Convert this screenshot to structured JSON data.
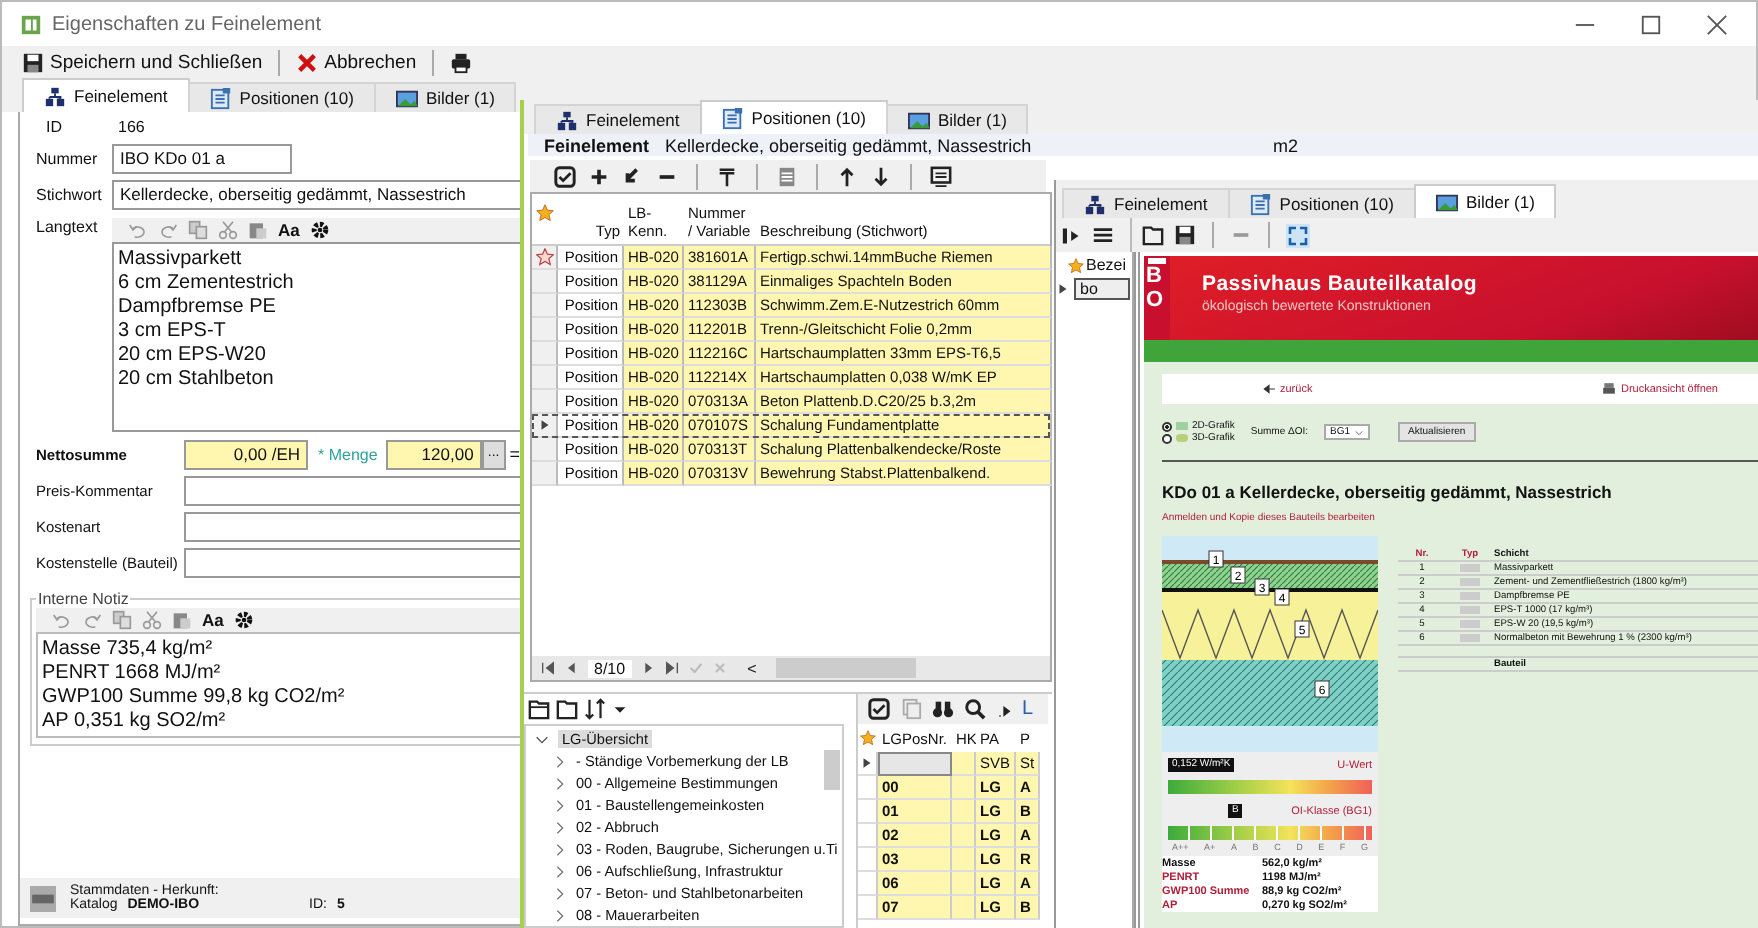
{
  "window": {
    "title": "Eigenschaften zu Feinelement"
  },
  "toolbar": [
    {
      "kind": "save",
      "label": "Speichern und Schließen"
    },
    {
      "kind": "cancel",
      "label": "Abbrechen"
    },
    {
      "kind": "print"
    }
  ],
  "tabs": [
    {
      "kind": "element",
      "label": "Feinelement",
      "selected": true
    },
    {
      "kind": "positions",
      "label": "Positionen (10)",
      "selected": false
    },
    {
      "kind": "images",
      "label": "Bilder (1)",
      "selected": false
    }
  ],
  "form": {
    "id_label": "ID",
    "id_value": "166",
    "fields": [
      {
        "label": "Nummer",
        "value": "IBO KDo  01 a"
      },
      {
        "label": "Stichwort",
        "value": "Kellerdecke, oberseitig gedämmt, Nassestrich"
      }
    ],
    "langtext": {
      "label": "Langtext",
      "font_button": "Aa",
      "lines": [
        "Massivparkett",
        "6 cm Zementestrich",
        "Dampfbremse PE",
        "3 cm EPS-T",
        "20 cm EPS-W20",
        "20 cm Stahlbeton"
      ]
    },
    "nettosumme": {
      "label": "Nettosumme",
      "price": "0,00 /EH",
      "quantity_label": "* Menge",
      "quantity": "120,00",
      "browse_button": "...",
      "equals": "="
    },
    "extra_fields": [
      {
        "label": "Preis-Kommentar"
      },
      {
        "label": "Kostenart"
      },
      {
        "label": "Kostenstelle (Bauteil)"
      }
    ],
    "note": {
      "label": "Interne Notiz",
      "font_button": "Aa",
      "lines": [
        "Masse 735,4 kg/m²",
        "PENRT 1668 MJ/m²",
        "GWP100 Summe 99,8 kg CO2/m²",
        "AP 0,351 kg SO2/m²"
      ]
    },
    "footer": {
      "heading": "Stammdaten - Herkunft:",
      "catalog_label": "Katalog",
      "catalog": "DEMO-IBO",
      "id_label": "ID:",
      "id": "5"
    }
  },
  "positions_window": {
    "tabs": [
      {
        "kind": "element",
        "label": "Feinelement",
        "selected": false
      },
      {
        "kind": "positions",
        "label": "Positionen (10)",
        "selected": true
      },
      {
        "kind": "images",
        "label": "Bilder (1)",
        "selected": false
      }
    ],
    "header": {
      "label": "Feinelement",
      "value": "Kellerdecke, oberseitig gedämmt, Nassestrich",
      "unit": "m2"
    },
    "table": {
      "columns": [
        "Typ",
        "LB-Kenn.",
        "Nummer / Variable",
        "Beschreibung (Stichwort)"
      ],
      "rows": [
        {
          "typ": "Position",
          "lb": "HB-020",
          "nummer": "381601A",
          "beschreibung": "Fertigp.schwi.14mmBuche Riemen",
          "starred": true,
          "selected": false
        },
        {
          "typ": "Position",
          "lb": "HB-020",
          "nummer": "381129A",
          "beschreibung": "Einmaliges Spachteln Boden",
          "starred": false,
          "selected": false
        },
        {
          "typ": "Position",
          "lb": "HB-020",
          "nummer": "112303B",
          "beschreibung": "Schwimm.Zem.E-Nutzestrich 60mm",
          "starred": false,
          "selected": false
        },
        {
          "typ": "Position",
          "lb": "HB-020",
          "nummer": "112201B",
          "beschreibung": "Trenn-/Gleitschicht Folie 0,2mm",
          "starred": false,
          "selected": false
        },
        {
          "typ": "Position",
          "lb": "HB-020",
          "nummer": "112216C",
          "beschreibung": "Hartschaumplatten 33mm EPS-T6,5",
          "starred": false,
          "selected": false
        },
        {
          "typ": "Position",
          "lb": "HB-020",
          "nummer": "112214X",
          "beschreibung": "Hartschaumplatten 0,038 W/mK EP",
          "starred": false,
          "selected": false
        },
        {
          "typ": "Position",
          "lb": "HB-020",
          "nummer": "070313A",
          "beschreibung": "Beton Plattenb.D.C20/25 b.3,2m",
          "starred": false,
          "selected": false
        },
        {
          "typ": "Position",
          "lb": "HB-020",
          "nummer": "070107S",
          "beschreibung": "Schalung Fundamentplatte",
          "starred": false,
          "selected": true
        },
        {
          "typ": "Position",
          "lb": "HB-020",
          "nummer": "070313T",
          "beschreibung": "Schalung Plattenbalkendecke/Roste",
          "starred": false,
          "selected": false
        },
        {
          "typ": "Position",
          "lb": "HB-020",
          "nummer": "070313V",
          "beschreibung": "Bewehrung Stabst.Plattenbalkend.",
          "starred": false,
          "selected": false
        }
      ]
    },
    "navigator": {
      "position": "8/10",
      "scroll_left": "<"
    },
    "lg_tree": {
      "label": "LG-Übersicht",
      "expanded": true,
      "children": [
        {
          "label": "- Ständige Vorbemerkung der LB",
          "expanded": false
        },
        {
          "label": "00 - Allgemeine Bestimmungen",
          "expanded": false
        },
        {
          "label": "01 - Baustellengemeinkosten",
          "expanded": false
        },
        {
          "label": "02 - Abbruch",
          "expanded": false
        },
        {
          "label": "03 - Roden, Baugrube, Sicherungen u.Ti",
          "expanded": false
        },
        {
          "label": "06 - Aufschließung, Infrastruktur",
          "expanded": false
        },
        {
          "label": "07 - Beton- und Stahlbetonarbeiten",
          "expanded": false
        },
        {
          "label": "08 - Mauerarbeiten",
          "expanded": false
        }
      ]
    },
    "lg_grid": {
      "toolbar_text": "L",
      "columns": [
        "LGPosNr.",
        "HK",
        "PA",
        "P"
      ],
      "rows": [
        {
          "cells": [
            null,
            null,
            "SVB",
            "St"
          ],
          "selected": true
        },
        {
          "cells": [
            "00",
            null,
            "LG",
            "A"
          ],
          "selected": false
        },
        {
          "cells": [
            "01",
            null,
            "LG",
            "B"
          ],
          "selected": false
        },
        {
          "cells": [
            "02",
            null,
            "LG",
            "A"
          ],
          "selected": false
        },
        {
          "cells": [
            "03",
            null,
            "LG",
            "R"
          ],
          "selected": false
        },
        {
          "cells": [
            "06",
            null,
            "LG",
            "A"
          ],
          "selected": false
        },
        {
          "cells": [
            "07",
            null,
            "LG",
            "B"
          ],
          "selected": false
        }
      ]
    }
  },
  "images_window": {
    "tabs": [
      {
        "kind": "element",
        "label": "Feinelement",
        "selected": false
      },
      {
        "kind": "positions",
        "label": "Positionen (10)",
        "selected": false
      },
      {
        "kind": "images",
        "label": "Bilder (1)",
        "selected": true
      }
    ],
    "side": {
      "header": "Bezei",
      "value": "bo"
    },
    "webpage": {
      "logo": "BO",
      "title": "Passivhaus Bauteilkatalog",
      "subtitle": "ökologisch bewertete Konstruktionen",
      "back_link": "zurück",
      "print_link": "Druckansicht öffnen",
      "view_options": [
        {
          "label": "2D-Grafik",
          "selected": true
        },
        {
          "label": "3D-Grafik",
          "selected": false
        }
      ],
      "sum_label": "Summe ΔOI:",
      "sum_value": "BG1",
      "refresh_button": "Aktualisieren",
      "heading": "KDo 01 a Kellerdecke, oberseitig gedämmt, Nassestrich",
      "edit_link": "Anmelden und Kopie dieses Bauteils bearbeiten",
      "drawing_labels": [
        "1",
        "2",
        "3",
        "4",
        "5",
        "6"
      ],
      "u_value": {
        "reading": "0,152 W/m²K",
        "label": "U-Wert"
      },
      "oi_class": {
        "reading": "B",
        "label": "OI-Klasse (BG1)",
        "scale": [
          "A++",
          "A+",
          "A",
          "B",
          "C",
          "D",
          "E",
          "F",
          "G"
        ]
      },
      "stats": [
        {
          "label": "Masse",
          "value": "562,0 kg/m²"
        },
        {
          "label": "PENRT",
          "value": "1198 MJ/m²"
        },
        {
          "label": "GWP100 Summe",
          "value": "88,9 kg CO2/m²"
        },
        {
          "label": "AP",
          "value": "0,270 kg SO2/m²"
        }
      ],
      "layers_columns": [
        "Nr.",
        "Typ",
        "Schicht"
      ],
      "layers": [
        {
          "nr": "1",
          "name": "Massivparkett"
        },
        {
          "nr": "2",
          "name": "Zement- und Zementfließestrich (1800 kg/m³)"
        },
        {
          "nr": "3",
          "name": "Dampfbremse PE"
        },
        {
          "nr": "4",
          "name": "EPS-T 1000 (17 kg/m³)"
        },
        {
          "nr": "5",
          "name": "EPS-W 20 (19,5 kg/m³)"
        },
        {
          "nr": "6",
          "name": "Normalbeton mit Bewehrung 1 % (2300 kg/m³)"
        }
      ],
      "layers_footer": "Bauteil"
    }
  }
}
